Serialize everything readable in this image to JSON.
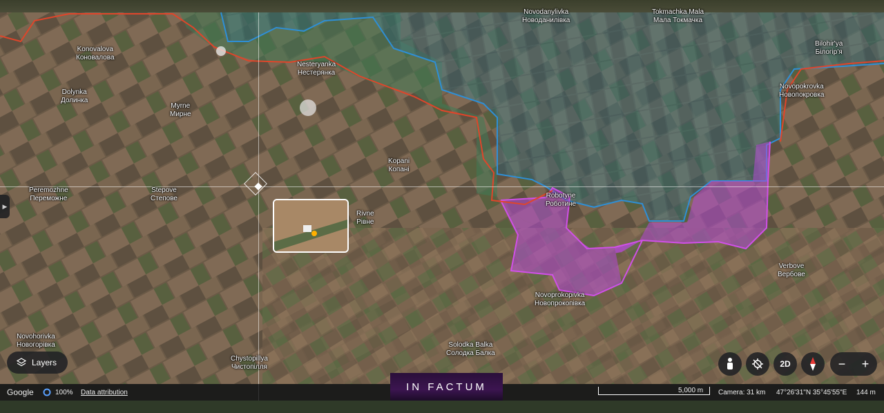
{
  "map": {
    "places": [
      {
        "en": "Konovalova",
        "uk": "Коновалова"
      },
      {
        "en": "Nesteryanka",
        "uk": "Нестерянка"
      },
      {
        "en": "Dolynka",
        "uk": "Долинка"
      },
      {
        "en": "Myrne",
        "uk": "Мирне"
      },
      {
        "en": "Kopani",
        "uk": "Копані"
      },
      {
        "en": "Peremozhne",
        "uk": "Переможне"
      },
      {
        "en": "Stepove",
        "uk": "Степове"
      },
      {
        "en": "Rivne",
        "uk": "Рівне"
      },
      {
        "en": "Robotyne",
        "uk": "Роботине"
      },
      {
        "en": "Novoprokopivka",
        "uk": "Новопрокопівка"
      },
      {
        "en": "Verbove",
        "uk": "Вербове"
      },
      {
        "en": "Novopokrovka",
        "uk": "Новопокровка"
      },
      {
        "en": "Novodanylivka",
        "uk": "Новоданилівка"
      },
      {
        "en": "Tokmachka Mala",
        "uk": "Мала Токмачка"
      },
      {
        "en": "Bilohir'ya",
        "uk": "Білогір'я"
      },
      {
        "en": "Novohorivka",
        "uk": "Новогорівка"
      },
      {
        "en": "Chystopillya",
        "uk": "Чистопілля"
      },
      {
        "en": "Solodka Balka",
        "uk": "Солодка Балка"
      }
    ],
    "colors": {
      "russian_front_line": "#e0452a",
      "blue_zone": "#2e8fd6",
      "purple_zone": "#c055e0"
    }
  },
  "controls": {
    "layers_label": "Layers",
    "two_d_label": "2D",
    "zoom_out": "−",
    "zoom_in": "+"
  },
  "footer": {
    "brand": "Google",
    "loading_pct": "100%",
    "attribution": "Data attribution",
    "scale": "5,000 m",
    "camera": "Camera: 31 km",
    "coords": "47°26'31\"N 35°45'55\"E",
    "elevation": "144 m"
  },
  "watermark": "IN FACTUM"
}
